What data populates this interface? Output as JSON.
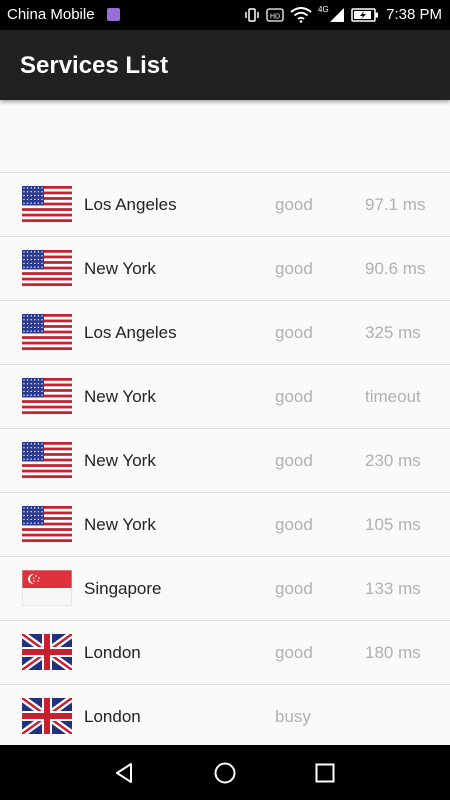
{
  "status_bar": {
    "carrier": "China Mobile",
    "network": "4G",
    "time": "7:38 PM"
  },
  "app_bar": {
    "title": "Services List"
  },
  "services": [
    {
      "city": "Los Angeles",
      "status": "good",
      "latency": "97.1 ms",
      "flag": "us-flag-icon"
    },
    {
      "city": "New York",
      "status": "good",
      "latency": "90.6 ms",
      "flag": "us-flag-icon"
    },
    {
      "city": "Los Angeles",
      "status": "good",
      "latency": "325 ms",
      "flag": "us-flag-icon"
    },
    {
      "city": "New York",
      "status": "good",
      "latency": "timeout",
      "flag": "us-flag-icon"
    },
    {
      "city": "New York",
      "status": "good",
      "latency": "230 ms",
      "flag": "us-flag-icon"
    },
    {
      "city": "New York",
      "status": "good",
      "latency": "105 ms",
      "flag": "us-flag-icon"
    },
    {
      "city": "Singapore",
      "status": "good",
      "latency": "133 ms",
      "flag": "singapore-flag-icon"
    },
    {
      "city": "London",
      "status": "good",
      "latency": "180 ms",
      "flag": "uk-flag-icon"
    },
    {
      "city": "London",
      "status": "busy",
      "latency": "",
      "flag": "uk-flag-icon"
    }
  ],
  "nav_bar": {
    "buttons": [
      "back-icon",
      "home-icon",
      "recents-icon"
    ]
  },
  "colors": {
    "app_bar": "#212121",
    "muted_text": "#b0b0b0",
    "divider": "#dcdcdc"
  }
}
